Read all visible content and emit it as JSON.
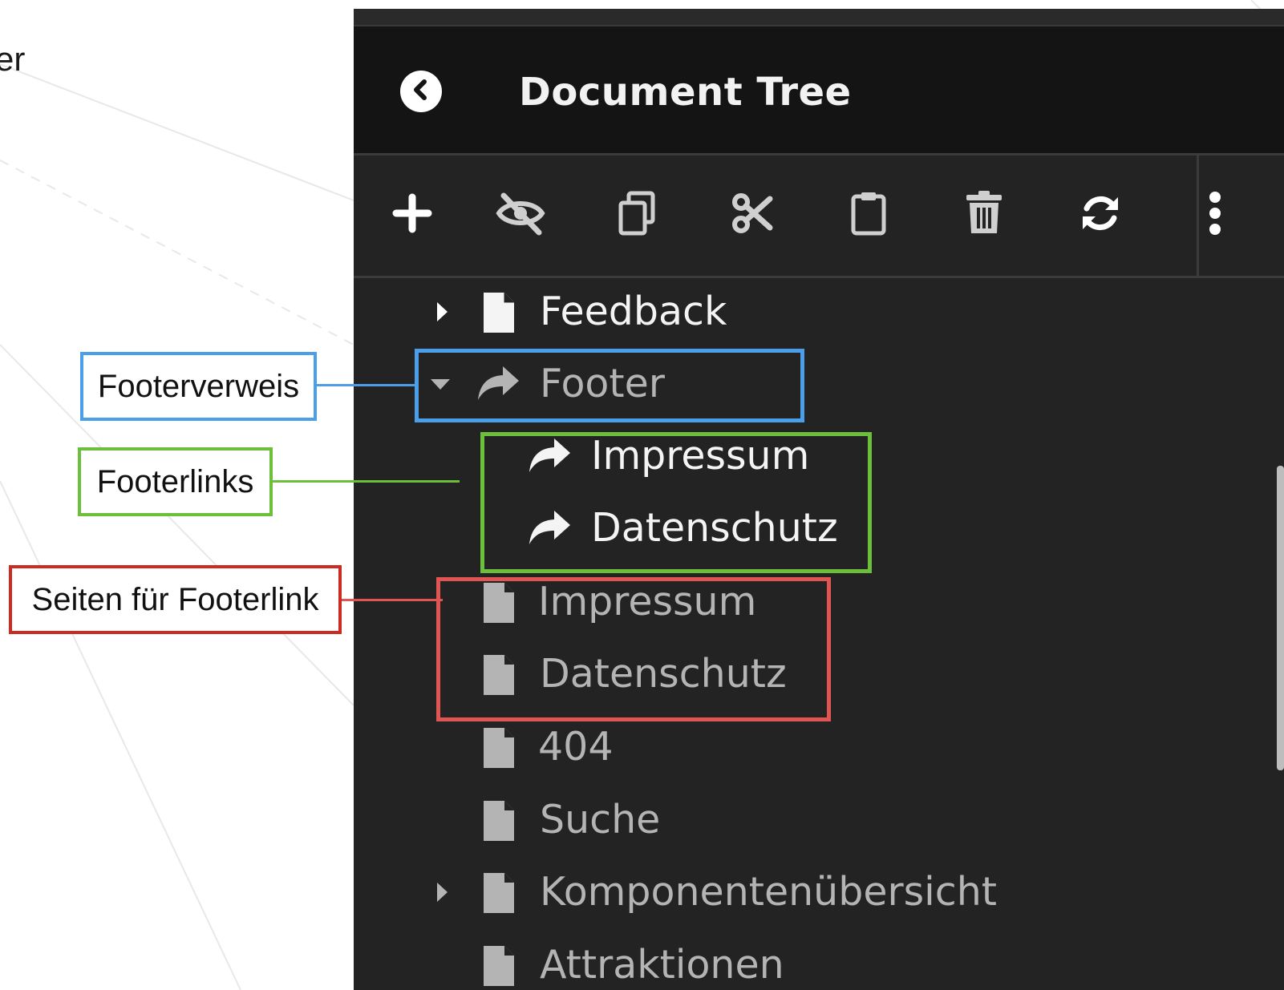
{
  "background": {
    "partial_text": "er"
  },
  "panel": {
    "title": "Document Tree",
    "back_icon": "chevron-left-circle-icon",
    "toolbar": [
      {
        "name": "add",
        "icon": "plus-icon"
      },
      {
        "name": "hide",
        "icon": "eye-slash-icon"
      },
      {
        "name": "copy",
        "icon": "copy-icon"
      },
      {
        "name": "cut",
        "icon": "scissors-icon"
      },
      {
        "name": "paste",
        "icon": "clipboard-icon"
      },
      {
        "name": "delete",
        "icon": "trash-icon"
      },
      {
        "name": "refresh",
        "icon": "refresh-icon"
      },
      {
        "name": "more",
        "icon": "vertical-ellipsis-icon"
      }
    ]
  },
  "tree": [
    {
      "label": "Feedback",
      "type": "page",
      "toggle": "collapsed",
      "tone": "white"
    },
    {
      "label": "Footer",
      "type": "link",
      "toggle": "expanded",
      "tone": "grey"
    },
    {
      "label": "Impressum",
      "type": "link",
      "toggle": "none",
      "tone": "white"
    },
    {
      "label": "Datenschutz",
      "type": "link",
      "toggle": "none",
      "tone": "white"
    },
    {
      "label": "Impressum",
      "type": "page",
      "toggle": "none",
      "tone": "grey"
    },
    {
      "label": "Datenschutz",
      "type": "page",
      "toggle": "none",
      "tone": "grey"
    },
    {
      "label": "404",
      "type": "page",
      "toggle": "none",
      "tone": "grey"
    },
    {
      "label": "Suche",
      "type": "page",
      "toggle": "none",
      "tone": "grey"
    },
    {
      "label": "Komponentenübersicht",
      "type": "page",
      "toggle": "collapsed",
      "tone": "grey"
    },
    {
      "label": "Attraktionen",
      "type": "page",
      "toggle": "none",
      "tone": "grey"
    }
  ],
  "annotations": [
    {
      "label": "Footerverweis",
      "color": "#4a9fe8"
    },
    {
      "label": "Footerlinks",
      "color": "#6cbf3a"
    },
    {
      "label": "Seiten für Footerlink",
      "color": "#cc2b22"
    }
  ],
  "colors": {
    "panel_bg": "#232323",
    "header_bg": "#141414",
    "blue": "#4a9fe8",
    "green": "#6cbf3a",
    "red": "#cc2b22",
    "red_box": "#e05552"
  }
}
